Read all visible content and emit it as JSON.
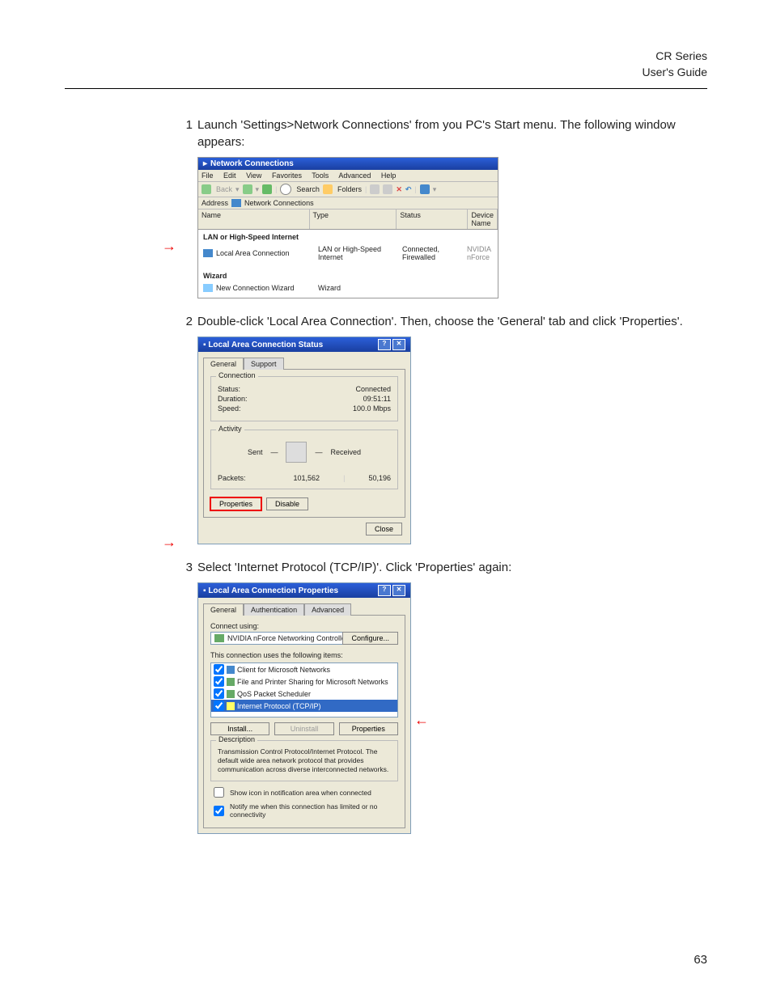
{
  "header": {
    "line1": "CR Series",
    "line2": "User's Guide"
  },
  "steps": {
    "s1_num": "1",
    "s1_text": "Launch 'Settings>Network Connections' from you PC's Start menu. The following window appears:",
    "s2_num": "2",
    "s2_text": "Double-click 'Local Area Connection'. Then, choose the 'General' tab and click 'Properties'.",
    "s3_num": "3",
    "s3_text": "Select 'Internet Protocol (TCP/IP)'. Click 'Properties' again:"
  },
  "ss1": {
    "title": "Network Connections",
    "menu": [
      "File",
      "Edit",
      "View",
      "Favorites",
      "Tools",
      "Advanced",
      "Help"
    ],
    "back": "Back",
    "search": "Search",
    "folders": "Folders",
    "addr_label": "Address",
    "addr_value": "Network Connections",
    "cols": {
      "name": "Name",
      "type": "Type",
      "status": "Status",
      "device": "Device Name"
    },
    "group": "LAN or High-Speed Internet",
    "row1": {
      "name": "Local Area Connection",
      "type": "LAN or High-Speed Internet",
      "status": "Connected, Firewalled",
      "device": "NVIDIA nForce"
    },
    "group2": "Wizard",
    "row2": {
      "name": "New Connection Wizard",
      "type": "Wizard"
    }
  },
  "ss2": {
    "title": "Local Area Connection Status",
    "tab_general": "General",
    "tab_support": "Support",
    "conn_legend": "Connection",
    "status_l": "Status:",
    "status_v": "Connected",
    "dur_l": "Duration:",
    "dur_v": "09:51:11",
    "speed_l": "Speed:",
    "speed_v": "100.0 Mbps",
    "act_legend": "Activity",
    "sent": "Sent",
    "received": "Received",
    "packets_l": "Packets:",
    "packets_sent": "101,562",
    "packets_recv": "50,196",
    "btn_props": "Properties",
    "btn_disable": "Disable",
    "btn_close": "Close"
  },
  "ss3": {
    "title": "Local Area Connection Properties",
    "tab_general": "General",
    "tab_auth": "Authentication",
    "tab_adv": "Advanced",
    "connect_using": "Connect using:",
    "nic": "NVIDIA nForce Networking Controller",
    "configure": "Configure...",
    "uses_label": "This connection uses the following items:",
    "items": [
      "Client for Microsoft Networks",
      "File and Printer Sharing for Microsoft Networks",
      "QoS Packet Scheduler",
      "Internet Protocol (TCP/IP)"
    ],
    "btn_install": "Install...",
    "btn_uninstall": "Uninstall",
    "btn_props": "Properties",
    "desc_legend": "Description",
    "desc_text": "Transmission Control Protocol/Internet Protocol. The default wide area network protocol that provides communication across diverse interconnected networks.",
    "chk1": "Show icon in notification area when connected",
    "chk2": "Notify me when this connection has limited or no connectivity"
  },
  "page_number": "63"
}
